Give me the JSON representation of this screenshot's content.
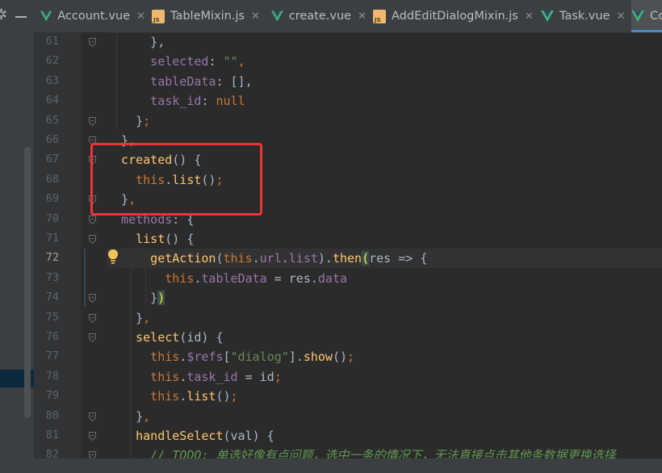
{
  "tabs": [
    {
      "label": "Account.vue",
      "icon": "vue-icon",
      "closable": true
    },
    {
      "label": "TableMixin.js",
      "icon": "js-icon",
      "closable": true
    },
    {
      "label": "create.vue",
      "icon": "vue-icon",
      "closable": true
    },
    {
      "label": "AddEditDialogMixin.js",
      "icon": "js-icon",
      "closable": true
    },
    {
      "label": "Task.vue",
      "icon": "vue-icon",
      "closable": true
    },
    {
      "label": "Co",
      "icon": "vue-icon",
      "closable": false,
      "active": true
    }
  ],
  "editor": {
    "current_line": 72,
    "lines": [
      {
        "n": "61",
        "t": [
          [
            "pun",
            "      },"
          ]
        ]
      },
      {
        "n": "62",
        "t": [
          [
            "prop",
            "      selected"
          ],
          [
            "pun",
            ": "
          ],
          [
            "str",
            "\"\""
          ],
          [
            "kw",
            ","
          ]
        ]
      },
      {
        "n": "63",
        "t": [
          [
            "prop",
            "      tableData"
          ],
          [
            "pun",
            ": [],"
          ]
        ]
      },
      {
        "n": "64",
        "t": [
          [
            "prop",
            "      task_id"
          ],
          [
            "pun",
            ": "
          ],
          [
            "kw",
            "null"
          ]
        ]
      },
      {
        "n": "65",
        "t": [
          [
            "pun",
            "    }"
          ],
          [
            "kw",
            ";"
          ]
        ]
      },
      {
        "n": "66",
        "t": [
          [
            "pun",
            "  },"
          ]
        ]
      },
      {
        "n": "67",
        "t": [
          [
            "fn",
            "  created"
          ],
          [
            "pun",
            "() {"
          ]
        ]
      },
      {
        "n": "68",
        "t": [
          [
            "kw",
            "    this"
          ],
          [
            "pun",
            "."
          ],
          [
            "fn",
            "list"
          ],
          [
            "pun",
            "()"
          ],
          [
            "kw",
            ";"
          ]
        ]
      },
      {
        "n": "69",
        "t": [
          [
            "pun",
            "  }"
          ],
          [
            "kw",
            ","
          ]
        ]
      },
      {
        "n": "70",
        "t": [
          [
            "prop",
            "  methods"
          ],
          [
            "pun",
            ": {"
          ]
        ]
      },
      {
        "n": "71",
        "t": [
          [
            "fn",
            "    list"
          ],
          [
            "pun",
            "() {"
          ]
        ]
      },
      {
        "n": "72",
        "t": [
          [
            "fn",
            "      getAction"
          ],
          [
            "pun",
            "("
          ],
          [
            "kw",
            "this"
          ],
          [
            "pun",
            "."
          ],
          [
            "prop",
            "url"
          ],
          [
            "pun",
            "."
          ],
          [
            "prop",
            "list"
          ],
          [
            "pun",
            ")."
          ],
          [
            "fn",
            "then"
          ],
          [
            "brace",
            "("
          ],
          [
            "plain",
            "res => {"
          ]
        ]
      },
      {
        "n": "73",
        "t": [
          [
            "kw",
            "        this"
          ],
          [
            "pun",
            "."
          ],
          [
            "prop",
            "tableData"
          ],
          [
            "pun",
            " = res."
          ],
          [
            "prop",
            "data"
          ]
        ]
      },
      {
        "n": "74",
        "t": [
          [
            "pun",
            "      }"
          ],
          [
            "brace",
            ")"
          ]
        ]
      },
      {
        "n": "75",
        "t": [
          [
            "pun",
            "    }"
          ],
          [
            "kw",
            ","
          ]
        ]
      },
      {
        "n": "76",
        "t": [
          [
            "fn",
            "    select"
          ],
          [
            "pun",
            "(id) {"
          ]
        ]
      },
      {
        "n": "77",
        "t": [
          [
            "kw",
            "      this"
          ],
          [
            "pun",
            "."
          ],
          [
            "prop",
            "$refs"
          ],
          [
            "pun",
            "["
          ],
          [
            "str",
            "\"dialog\""
          ],
          [
            "pun",
            "]."
          ],
          [
            "fn",
            "show"
          ],
          [
            "pun",
            "()"
          ],
          [
            "kw",
            ";"
          ]
        ]
      },
      {
        "n": "78",
        "t": [
          [
            "kw",
            "      this"
          ],
          [
            "pun",
            "."
          ],
          [
            "prop",
            "task_id"
          ],
          [
            "pun",
            " = id"
          ],
          [
            "kw",
            ";"
          ]
        ]
      },
      {
        "n": "79",
        "t": [
          [
            "kw",
            "      this"
          ],
          [
            "pun",
            "."
          ],
          [
            "fn",
            "list"
          ],
          [
            "pun",
            "()"
          ],
          [
            "kw",
            ";"
          ]
        ]
      },
      {
        "n": "80",
        "t": [
          [
            "pun",
            "    }"
          ],
          [
            "kw",
            ","
          ]
        ]
      },
      {
        "n": "81",
        "t": [
          [
            "fn",
            "    handleSelect"
          ],
          [
            "pun",
            "(val) {"
          ]
        ]
      },
      {
        "n": "82",
        "t": [
          [
            "cmt",
            "      // TODO: 单选好像有点问题，选中一条的情况下，无法直接点击其他条数据更换选择"
          ]
        ]
      }
    ]
  },
  "colors": {
    "editor_bg": "#2b2b2b",
    "keyword": "#cc7832",
    "property": "#9876aa",
    "string": "#6a8759",
    "function": "#ffc66d",
    "highlight_box": "#ee3333"
  }
}
